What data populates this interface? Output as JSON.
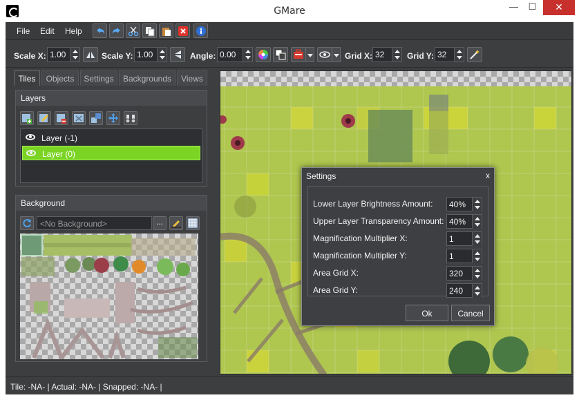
{
  "window": {
    "title": "GMare",
    "minimize": "—",
    "maximize": "☐",
    "close": "✕"
  },
  "menu": {
    "file": "File",
    "edit": "Edit",
    "help": "Help"
  },
  "toolbar": {
    "scale_x_label": "Scale X:",
    "scale_x_value": "1.00",
    "scale_y_label": "Scale Y:",
    "scale_y_value": "1.00",
    "angle_label": "Angle:",
    "angle_value": "0.00",
    "grid_x_label": "Grid X:",
    "grid_x_value": "32",
    "grid_y_label": "Grid Y:",
    "grid_y_value": "32"
  },
  "tabs": [
    {
      "label": "Tiles",
      "active": true
    },
    {
      "label": "Objects"
    },
    {
      "label": "Settings"
    },
    {
      "label": "Backgrounds"
    },
    {
      "label": "Views"
    }
  ],
  "layers": {
    "header": "Layers",
    "items": [
      {
        "label": "Layer (-1)",
        "selected": false
      },
      {
        "label": "Layer (0)",
        "selected": true
      }
    ]
  },
  "background": {
    "header": "Background",
    "selected": "<No Background>",
    "browse_label": "..."
  },
  "settings_dialog": {
    "title": "Settings",
    "close": "x",
    "fields": [
      {
        "label": "Lower Layer Brightness Amount:",
        "value": "40%"
      },
      {
        "label": "Upper Layer Transparency Amount:",
        "value": "40%"
      },
      {
        "label": "Magnification Multiplier X:",
        "value": "1"
      },
      {
        "label": "Magnification Multiplier Y:",
        "value": "1"
      },
      {
        "label": "Area Grid X:",
        "value": "320"
      },
      {
        "label": "Area Grid Y:",
        "value": "240"
      }
    ],
    "ok_label": "Ok",
    "cancel_label": "Cancel"
  },
  "status": {
    "text": "Tile: -NA- | Actual: -NA- | Snapped: -NA- |"
  },
  "colors": {
    "accent": "#7bd424",
    "grass": "#c5d14a",
    "close": "#c7302c"
  }
}
